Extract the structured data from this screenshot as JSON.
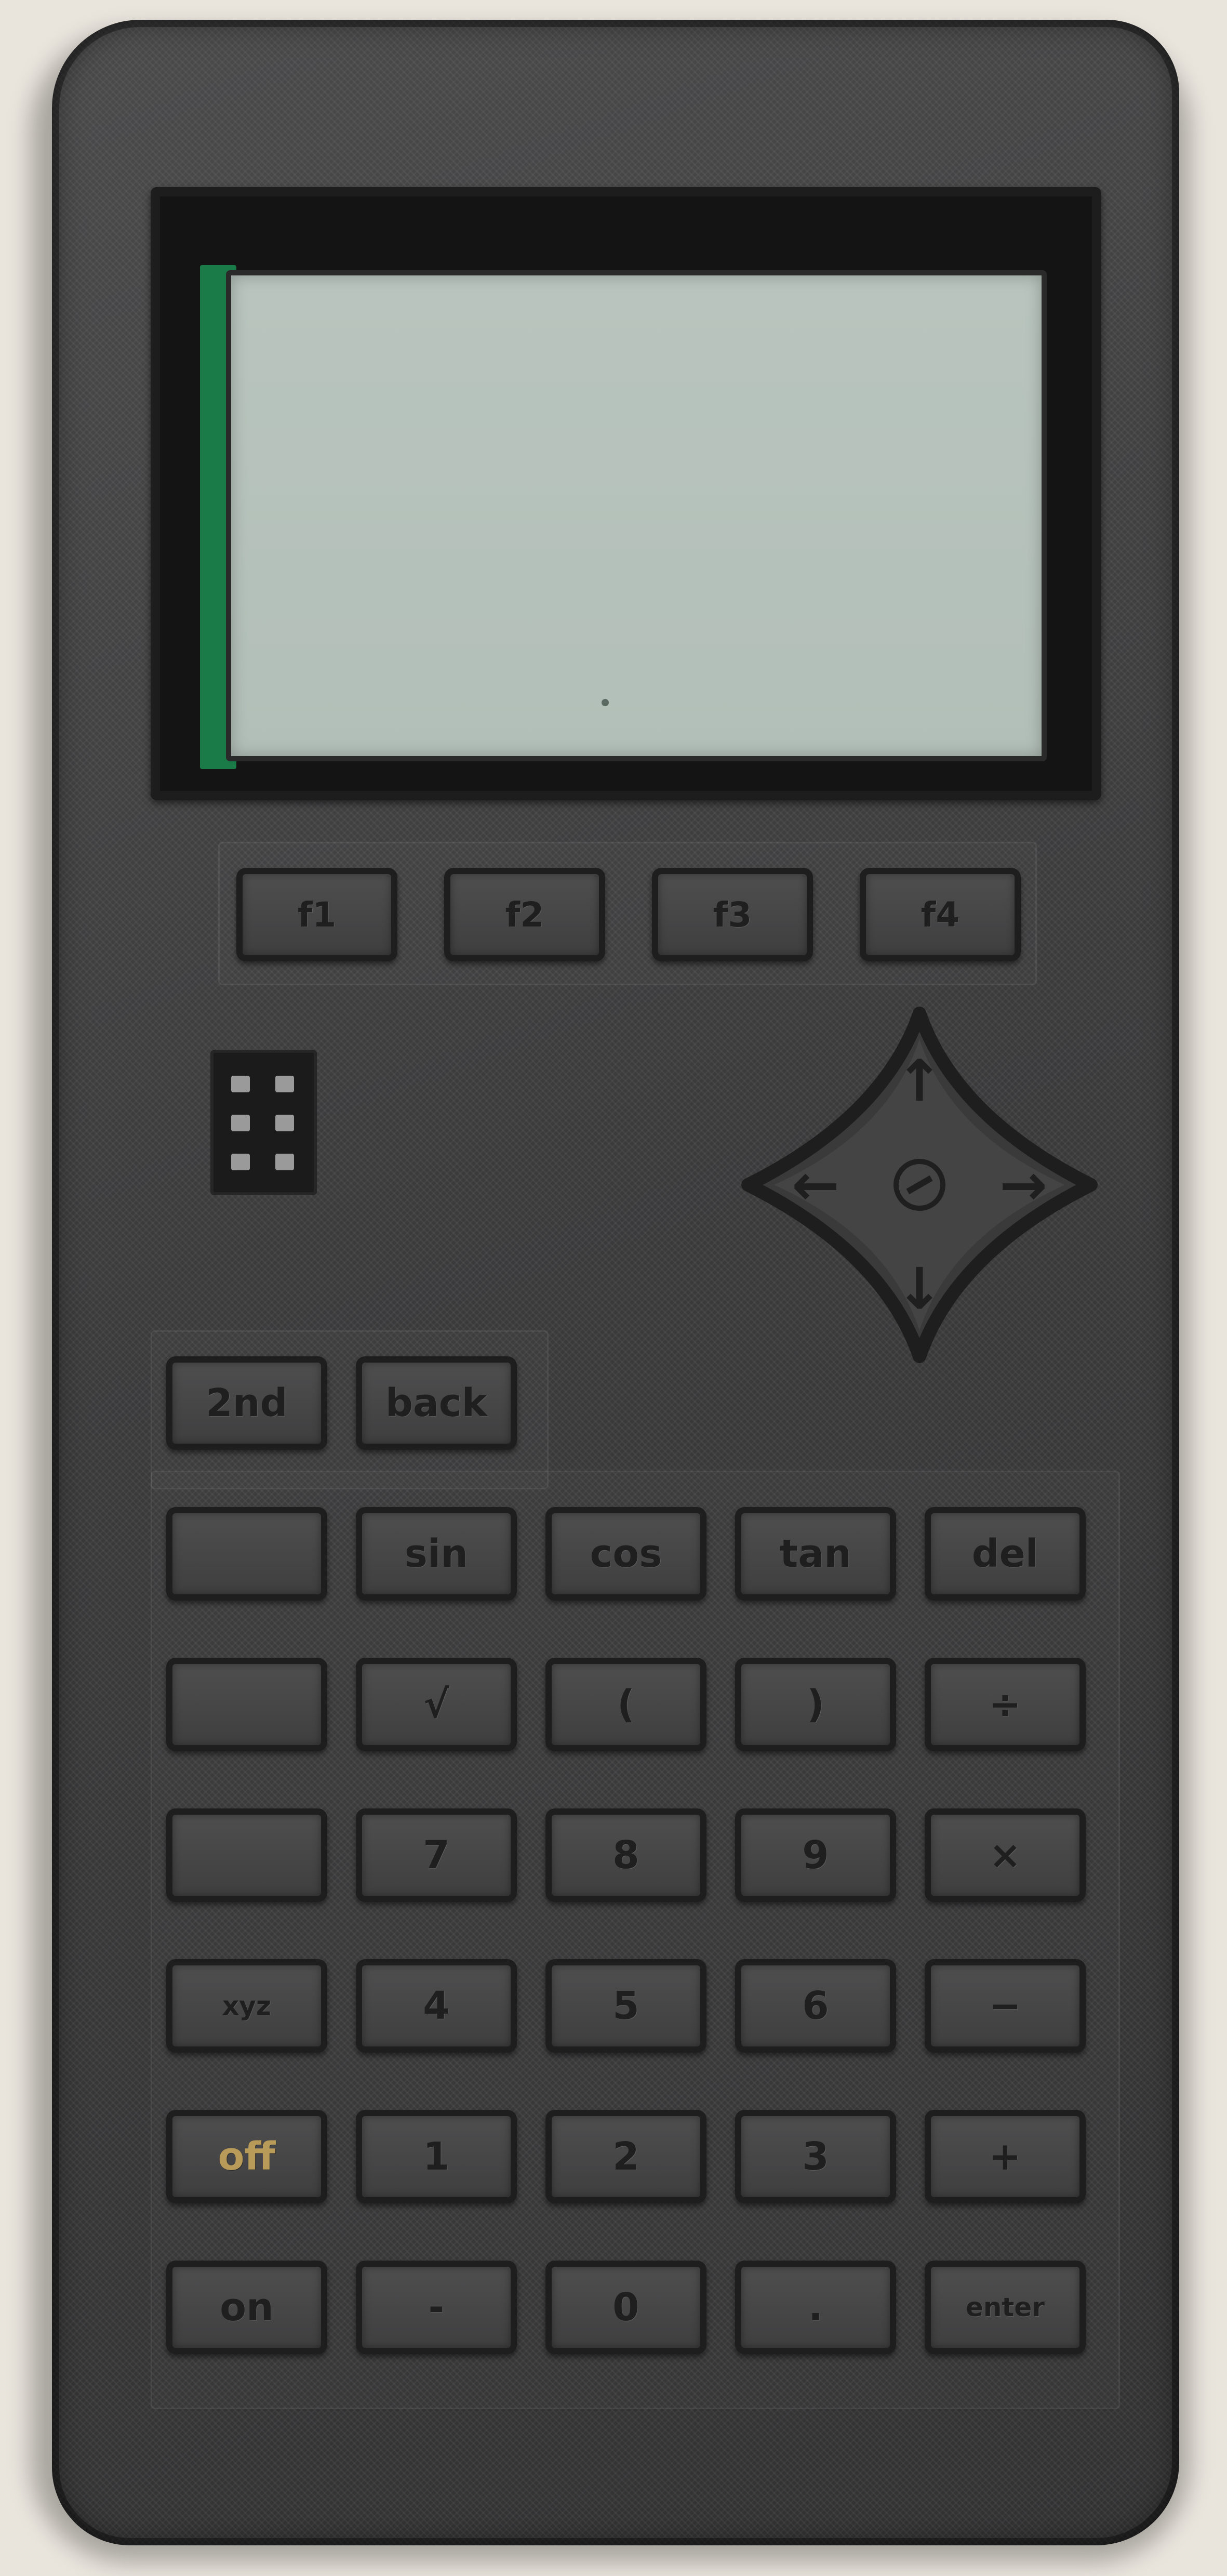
{
  "function_keys": [
    "f1",
    "f2",
    "f3",
    "f4"
  ],
  "top_keys": [
    "2nd",
    "back"
  ],
  "key_rows": [
    [
      "",
      "sin",
      "cos",
      "tan",
      "del"
    ],
    [
      "",
      "√",
      "(",
      ")",
      "÷"
    ],
    [
      "",
      "7",
      "8",
      "9",
      "×"
    ],
    [
      "xyz",
      "4",
      "5",
      "6",
      "−"
    ],
    [
      "off",
      "1",
      "2",
      "3",
      "+"
    ],
    [
      "on",
      "-",
      "0",
      ".",
      "enter"
    ]
  ],
  "dpad_arrows": [
    "↑",
    "↓",
    "←",
    "→"
  ],
  "colors": {
    "case": "#3b3b3c",
    "screen": "#b5c2bb",
    "off_label": "#b89b58",
    "pcb": "#1a7a48"
  }
}
